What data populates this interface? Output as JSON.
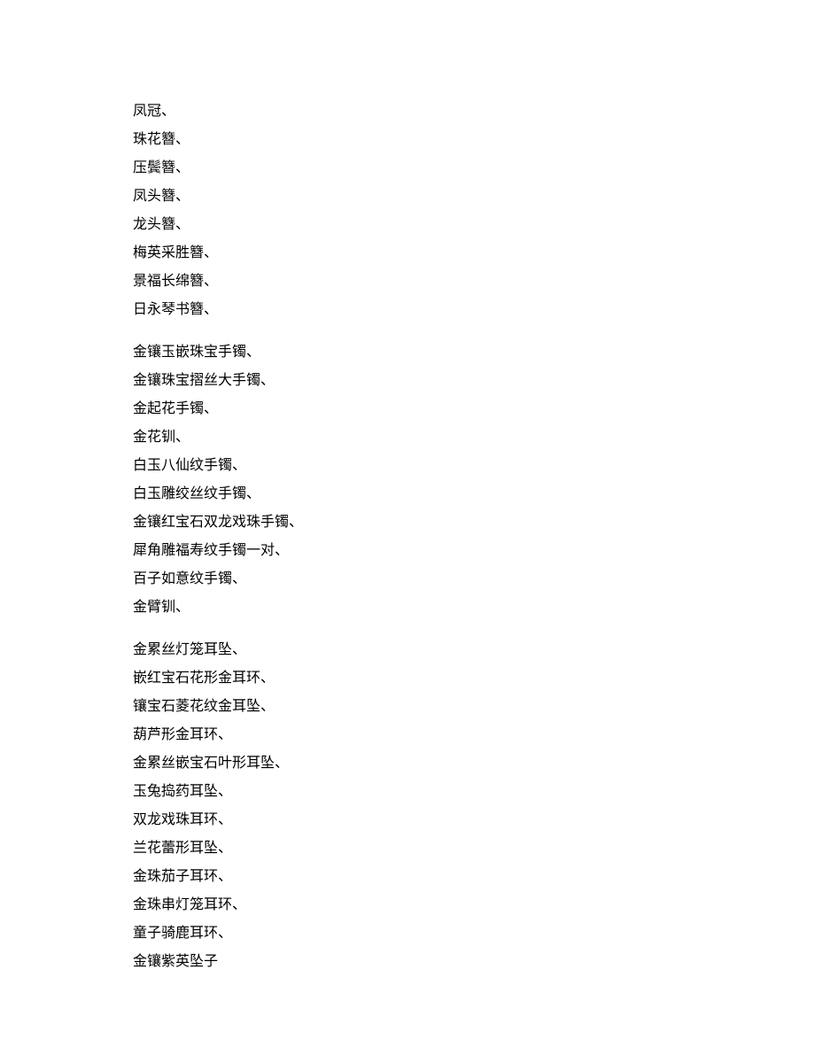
{
  "groups": [
    {
      "lines": [
        "凤冠、",
        "珠花簪、",
        "压鬓簪、",
        "凤头簪、",
        "龙头簪、",
        "梅英采胜簪、",
        "景福长绵簪、",
        "日永琴书簪、"
      ]
    },
    {
      "lines": [
        "金镶玉嵌珠宝手镯、",
        "金镶珠宝摺丝大手镯、",
        "金起花手镯、",
        "金花钏、",
        "白玉八仙纹手镯、",
        "白玉雕绞丝纹手镯、",
        "金镶红宝石双龙戏珠手镯、",
        "犀角雕福寿纹手镯一对、",
        "百子如意纹手镯、",
        "金臂钏、"
      ]
    },
    {
      "lines": [
        "金累丝灯笼耳坠、",
        "嵌红宝石花形金耳环、",
        "镶宝石菱花纹金耳坠、",
        "葫芦形金耳环、",
        "金累丝嵌宝石叶形耳坠、",
        "玉兔捣药耳坠、",
        "双龙戏珠耳环、",
        "兰花蕾形耳坠、",
        "金珠茄子耳环、",
        "金珠串灯笼耳环、",
        "童子骑鹿耳环、",
        "金镶紫英坠子"
      ]
    }
  ]
}
